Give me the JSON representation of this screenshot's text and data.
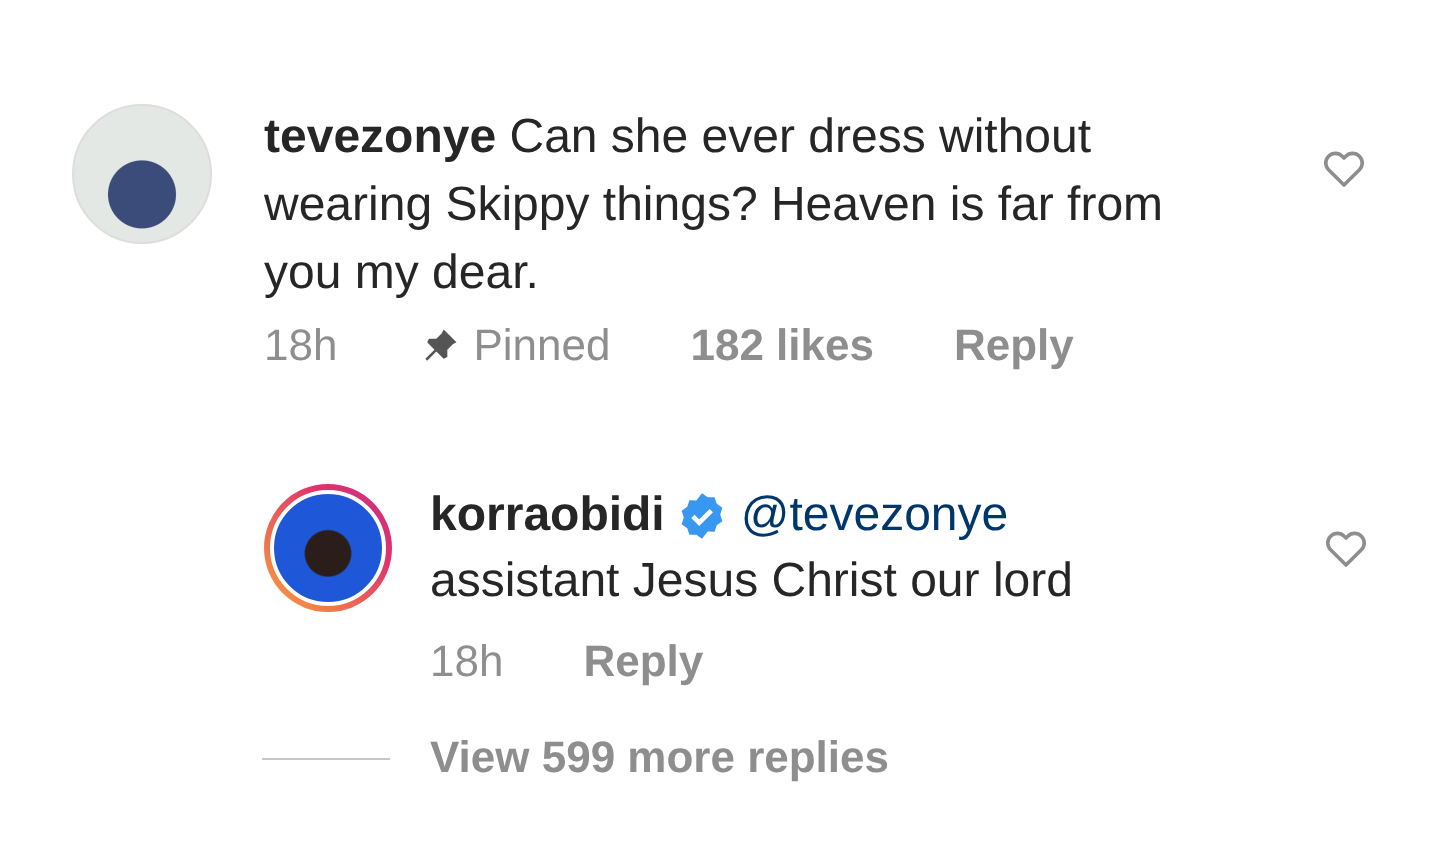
{
  "comment": {
    "username": "tevezonye",
    "text": "Can she ever dress without wearing Skippy things? Heaven is far from you my dear.",
    "time": "18h",
    "pinned": true,
    "pinned_label": "Pinned",
    "likes": "182 likes",
    "reply_button": "Reply",
    "liked": false
  },
  "reply": {
    "username": "korraobidi",
    "verified": true,
    "story_ring": true,
    "mention": "@tevezonye",
    "text": "assistant Jesus Christ our lord",
    "time": "18h",
    "reply_button": "Reply",
    "liked": false
  },
  "view_more": "View 599 more replies"
}
